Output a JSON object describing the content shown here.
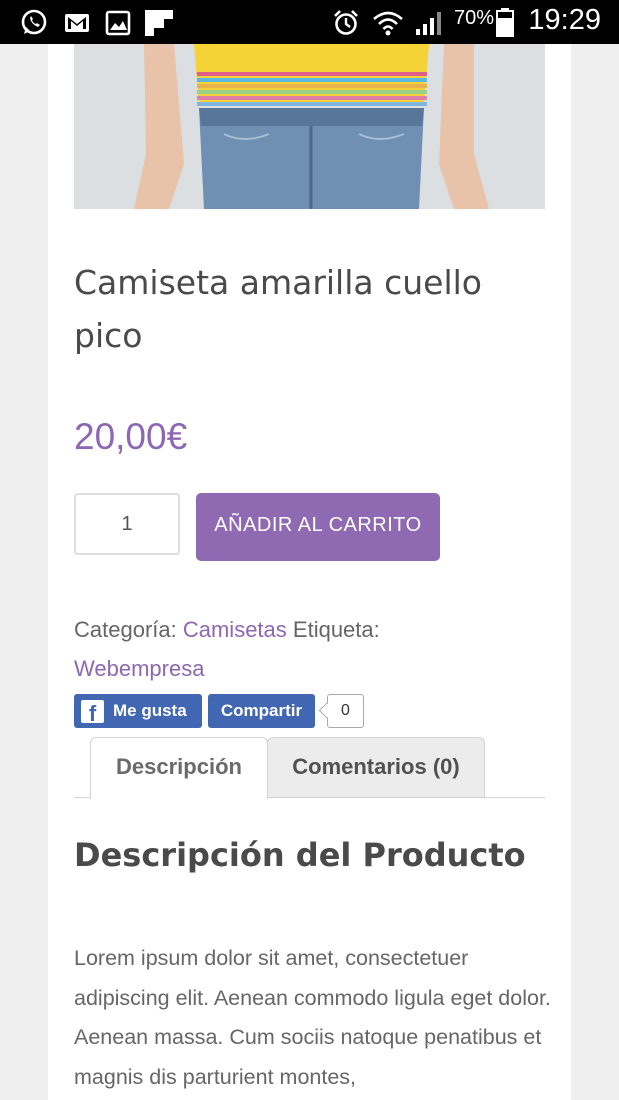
{
  "status_bar": {
    "icons": [
      "whatsapp-icon",
      "gmail-icon",
      "gallery-icon",
      "flipboard-icon",
      "alarm-icon",
      "wifi-icon",
      "signal-icon",
      "battery-icon"
    ],
    "battery": "70%",
    "time": "19:29"
  },
  "product": {
    "image": "yellow-tshirt-photo",
    "title": "Camiseta amarilla cuello pico",
    "price": "20,00€",
    "quantity": "1",
    "add_to_cart": "AÑADIR AL CARRITO",
    "category_label": "Categoría:",
    "category": "Camisetas",
    "tag_label": "Etiqueta:",
    "tag": "Webempresa"
  },
  "social": {
    "like": "Me gusta",
    "share": "Compartir",
    "count": "0"
  },
  "tabs": [
    {
      "label": "Descripción",
      "active": true
    },
    {
      "label": "Comentarios (0)",
      "active": false
    }
  ],
  "description": {
    "heading": "Descripción del Producto",
    "text": "Lorem ipsum dolor sit amet, consectetuer adipiscing elit. Aenean commodo ligula eget dolor. Aenean massa. Cum sociis natoque penatibus et magnis dis parturient montes,"
  },
  "colors": {
    "accent": "#8f69b2",
    "facebook": "#4267b2"
  }
}
